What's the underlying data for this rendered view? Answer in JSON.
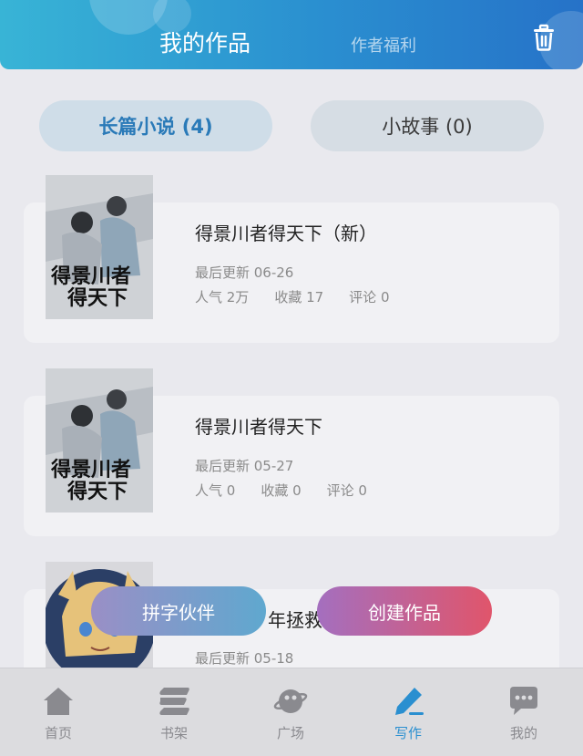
{
  "header": {
    "tab_main": "我的作品",
    "tab_sub": "作者福利",
    "trash_icon": "trash-icon"
  },
  "segments": {
    "long_novel": "长篇小说 (4)",
    "short_story": "小故事 (0)"
  },
  "works": [
    {
      "title": "得景川者得天下（新）",
      "updated": "最后更新 06-26",
      "popularity": "人气 2万",
      "favorites": "收藏 17",
      "comments": "评论 0"
    },
    {
      "title": "得景川者得天下",
      "updated": "最后更新 05-27",
      "popularity": "人气 0",
      "favorites": "收藏 0",
      "comments": "评论 0"
    },
    {
      "title": "年拯救",
      "updated": "最后更新 05-18"
    }
  ],
  "buttons": {
    "partner": "拼字伙伴",
    "create": "创建作品"
  },
  "nav": {
    "home": "首页",
    "bookshelf": "书架",
    "square": "广场",
    "write": "写作",
    "mine": "我的"
  },
  "colors": {
    "accent": "#2a8fd0",
    "header_start": "#38b4d6",
    "header_end": "#2672c8"
  }
}
